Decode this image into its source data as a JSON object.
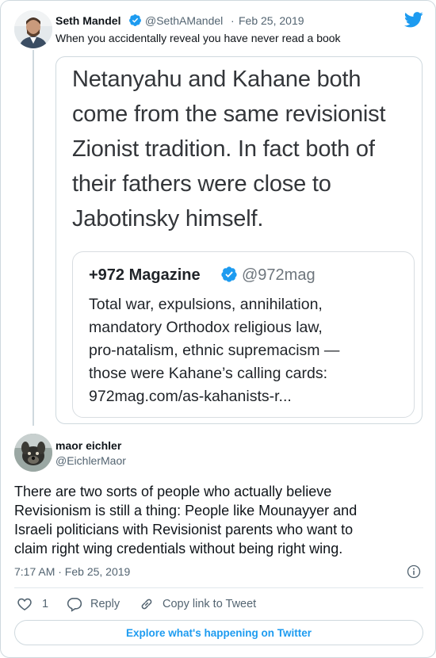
{
  "parent_tweet": {
    "name": "Seth Mandel",
    "handle": "@SethAMandel",
    "separator": "·",
    "date": "Feb 25, 2019",
    "text": "When you accidentally reveal you have never read a book",
    "avatar_icon": "user-photo-avatar",
    "verified_icon": "verified-badge-icon"
  },
  "embedded_image": {
    "text": "Netanyahu and Kahane both come from the same revisionist Zionist tradition. In fact both of their fathers were close to Jabotinsky himself.",
    "quote": {
      "name": "+972 Magazine",
      "handle": "@972mag",
      "lines": [
        "Total war, expulsions, annihilation,",
        "mandatory Orthodox religious law,",
        "pro-natalism, ethnic supremacism —",
        "those were Kahane’s calling cards:",
        "972mag.com/as-kahanists-r..."
      ]
    }
  },
  "reply_tweet": {
    "name": "maor eichler",
    "handle": "@EichlerMaor",
    "lines": [
      "There are two sorts of people who actually believe",
      "Revisionism is still a thing: People like Mounayyer and",
      "Israeli politicians with Revisionist parents who want to",
      "claim right wing credentials without being right wing."
    ],
    "timestamp": "7:17 AM · Feb 25, 2019",
    "avatar_icon": "dog-photo-avatar"
  },
  "actions": {
    "like_count": "1",
    "reply_label": "Reply",
    "copy_label": "Copy link to Tweet"
  },
  "footer": {
    "explore_label": "Explore what's happening on Twitter"
  },
  "colors": {
    "brand_blue": "#1d9bf0",
    "text_primary": "#0f1419",
    "text_secondary": "#536471",
    "border": "#cfd9de"
  }
}
